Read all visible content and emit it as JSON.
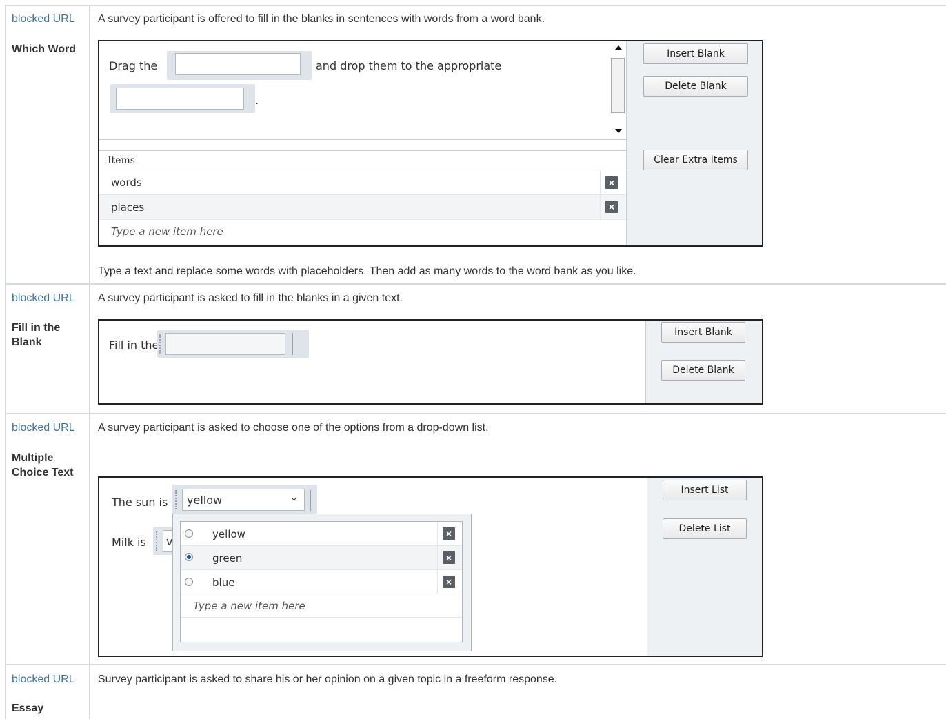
{
  "rows": [
    {
      "link": "blocked URL",
      "title": "Which Word",
      "description": "A survey participant is offered to fill in the blanks in sentences with words from a word bank.",
      "note": "Type a text and replace some words with placeholders. Then add as many words to the word bank as you like.",
      "sentence": {
        "part1": "Drag the",
        "part2": "and drop them to the appropriate",
        "end": "."
      },
      "buttons": {
        "insert": "Insert Blank",
        "delete": "Delete Blank",
        "clear": "Clear Extra Items"
      },
      "items_header": "Items",
      "items": [
        "words",
        "places"
      ],
      "new_item_placeholder": "Type a new item here"
    },
    {
      "link": "blocked URL",
      "title": "Fill in the Blank",
      "description": "A survey participant is asked to fill in the blanks in a given text.",
      "sentence": {
        "part1": "Fill in the"
      },
      "buttons": {
        "insert": "Insert Blank",
        "delete": "Delete Blank"
      }
    },
    {
      "link": "blocked URL",
      "title": "Multiple Choice Text",
      "description": "A survey participant is asked to choose one of the options from a drop-down list.",
      "sentence1": "The sun is",
      "sentence2": "Milk is",
      "selected_value": "yellow",
      "partial_value": "v",
      "buttons": {
        "insert": "Insert List",
        "delete": "Delete List"
      },
      "options": [
        {
          "label": "yellow",
          "checked": false
        },
        {
          "label": "green",
          "checked": true
        },
        {
          "label": "blue",
          "checked": false
        }
      ],
      "new_item_placeholder": "Type a new item here"
    },
    {
      "link": "blocked URL",
      "title": "Essay",
      "description": "Survey participant is asked to share his or her opinion on a given topic in a freeform response."
    }
  ],
  "icons": {
    "remove": "close-icon",
    "dropdown": "chevron-down-icon",
    "scroll_up": "arrow-up-icon",
    "scroll_down": "arrow-down-icon"
  }
}
